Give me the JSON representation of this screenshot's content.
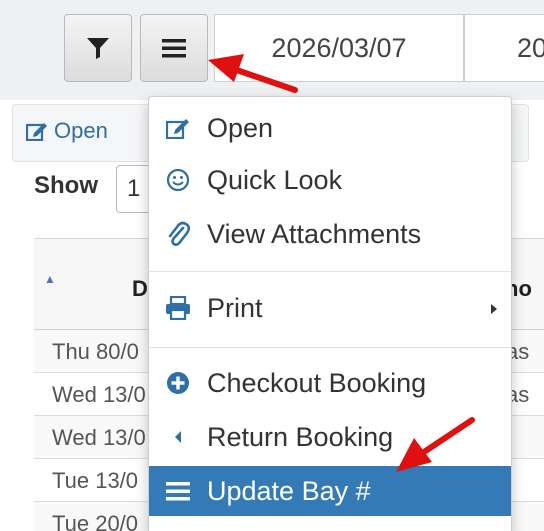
{
  "toolbar": {
    "date_from": "2026/03/07",
    "date_to_partial": "20"
  },
  "open_link": {
    "label": "Open"
  },
  "show": {
    "label": "Show",
    "value": "1"
  },
  "table": {
    "header_partial_left": "D",
    "header_partial_right": "ho",
    "rows": [
      {
        "date": "Thu 80/0",
        "right": "as"
      },
      {
        "date": "Wed 13/0",
        "right": "as"
      },
      {
        "date": "Wed 13/0",
        "right": ""
      },
      {
        "date": "Tue 13/0",
        "right": ""
      },
      {
        "date": "Tue 20/0",
        "right": ""
      }
    ]
  },
  "menu": {
    "items": [
      {
        "label": "Open",
        "icon": "edit-icon"
      },
      {
        "label": "Quick Look",
        "icon": "smile-icon"
      },
      {
        "label": "View Attachments",
        "icon": "paperclip-icon"
      },
      {
        "label": "Print",
        "icon": "printer-icon",
        "submenu": true
      },
      {
        "label": "Checkout Booking",
        "icon": "plus-circle-icon"
      },
      {
        "label": "Return Booking",
        "icon": "caret-left-icon"
      },
      {
        "label": "Update Bay #",
        "icon": "bars-icon",
        "active": true
      }
    ]
  },
  "colors": {
    "accent": "#337ab7",
    "icon_blue": "#2f6ea6",
    "annotation_red": "#e01010"
  }
}
